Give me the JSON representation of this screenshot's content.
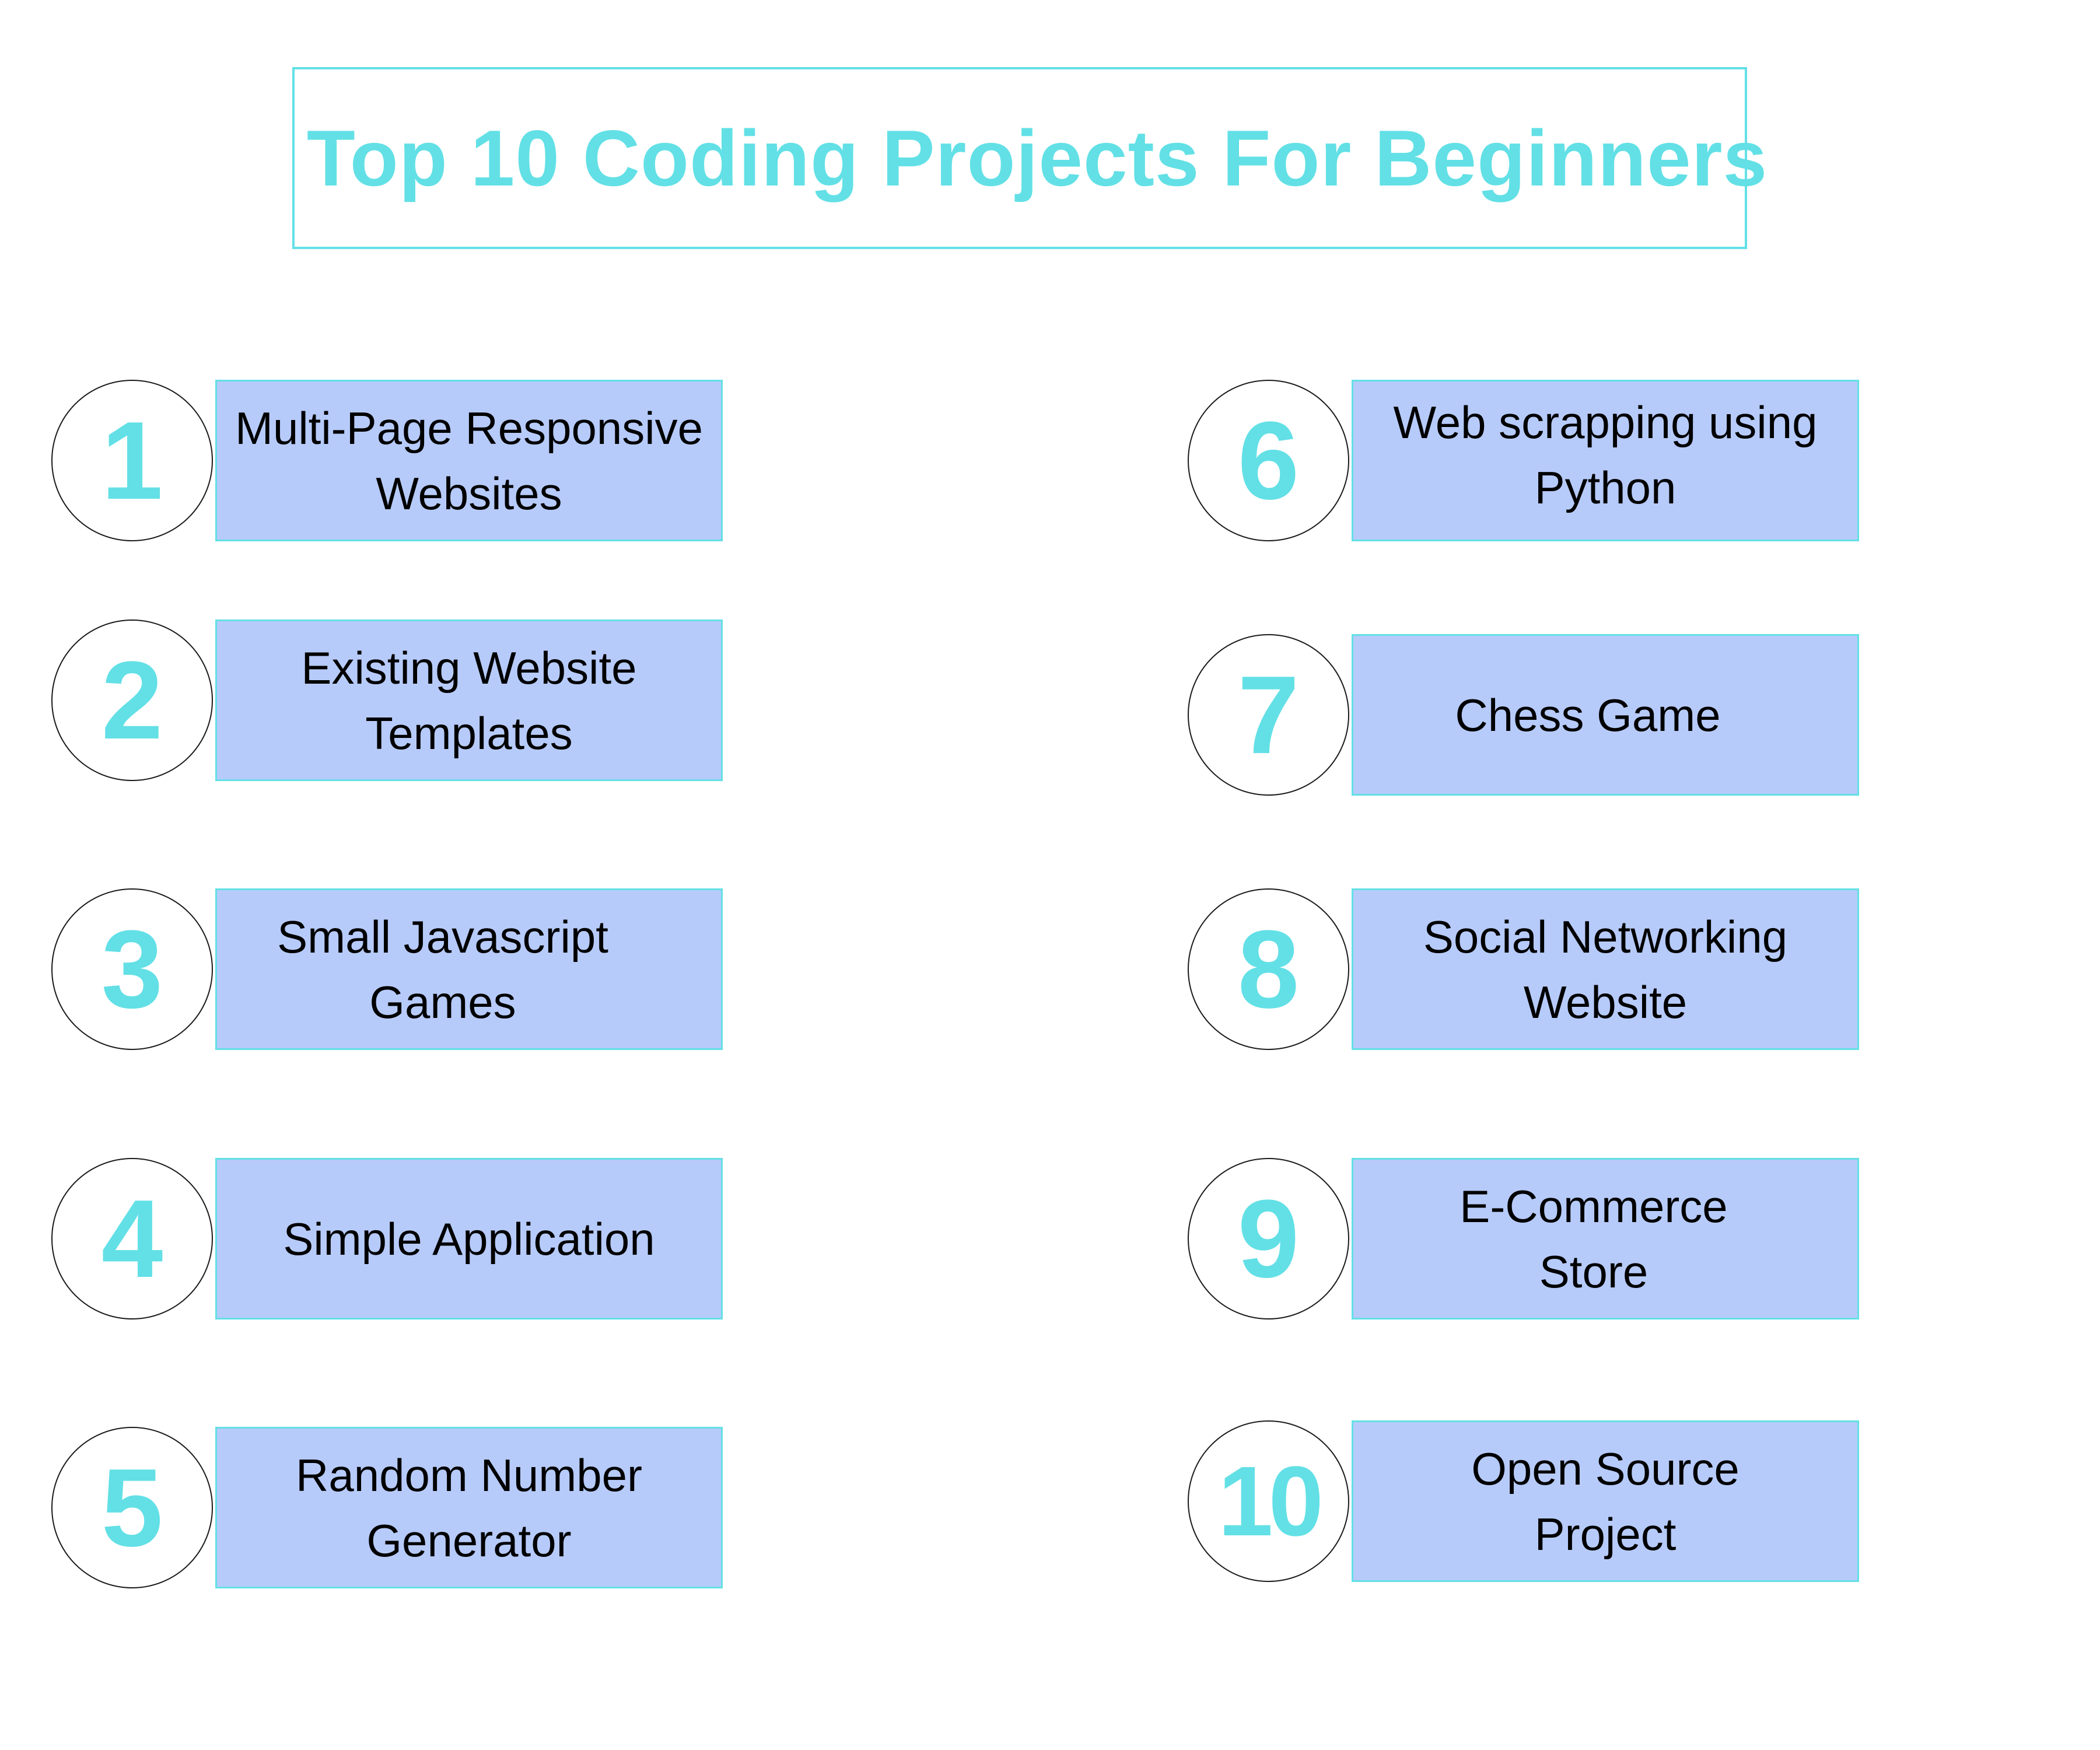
{
  "title": "Top 10 Coding Projects For Beginners",
  "colors": {
    "accent": "#62E0E6",
    "box_fill": "#B7CBFA",
    "circle_border": "#1a1a1a",
    "text": "#000000"
  },
  "projects": [
    {
      "number": "1",
      "label": "Multi-Page Responsive\nWebsites"
    },
    {
      "number": "2",
      "label": "Existing Website\nTemplates"
    },
    {
      "number": "3",
      "label": "Small Javascript\nGames"
    },
    {
      "number": "4",
      "label": "Simple Application"
    },
    {
      "number": "5",
      "label": "Random Number\nGenerator"
    },
    {
      "number": "6",
      "label": "Web scrapping using\nPython"
    },
    {
      "number": "7",
      "label": "Chess Game"
    },
    {
      "number": "8",
      "label": "Social Networking\nWebsite"
    },
    {
      "number": "9",
      "label": "E-Commerce\nStore"
    },
    {
      "number": "10",
      "label": "Open Source\nProject"
    }
  ]
}
